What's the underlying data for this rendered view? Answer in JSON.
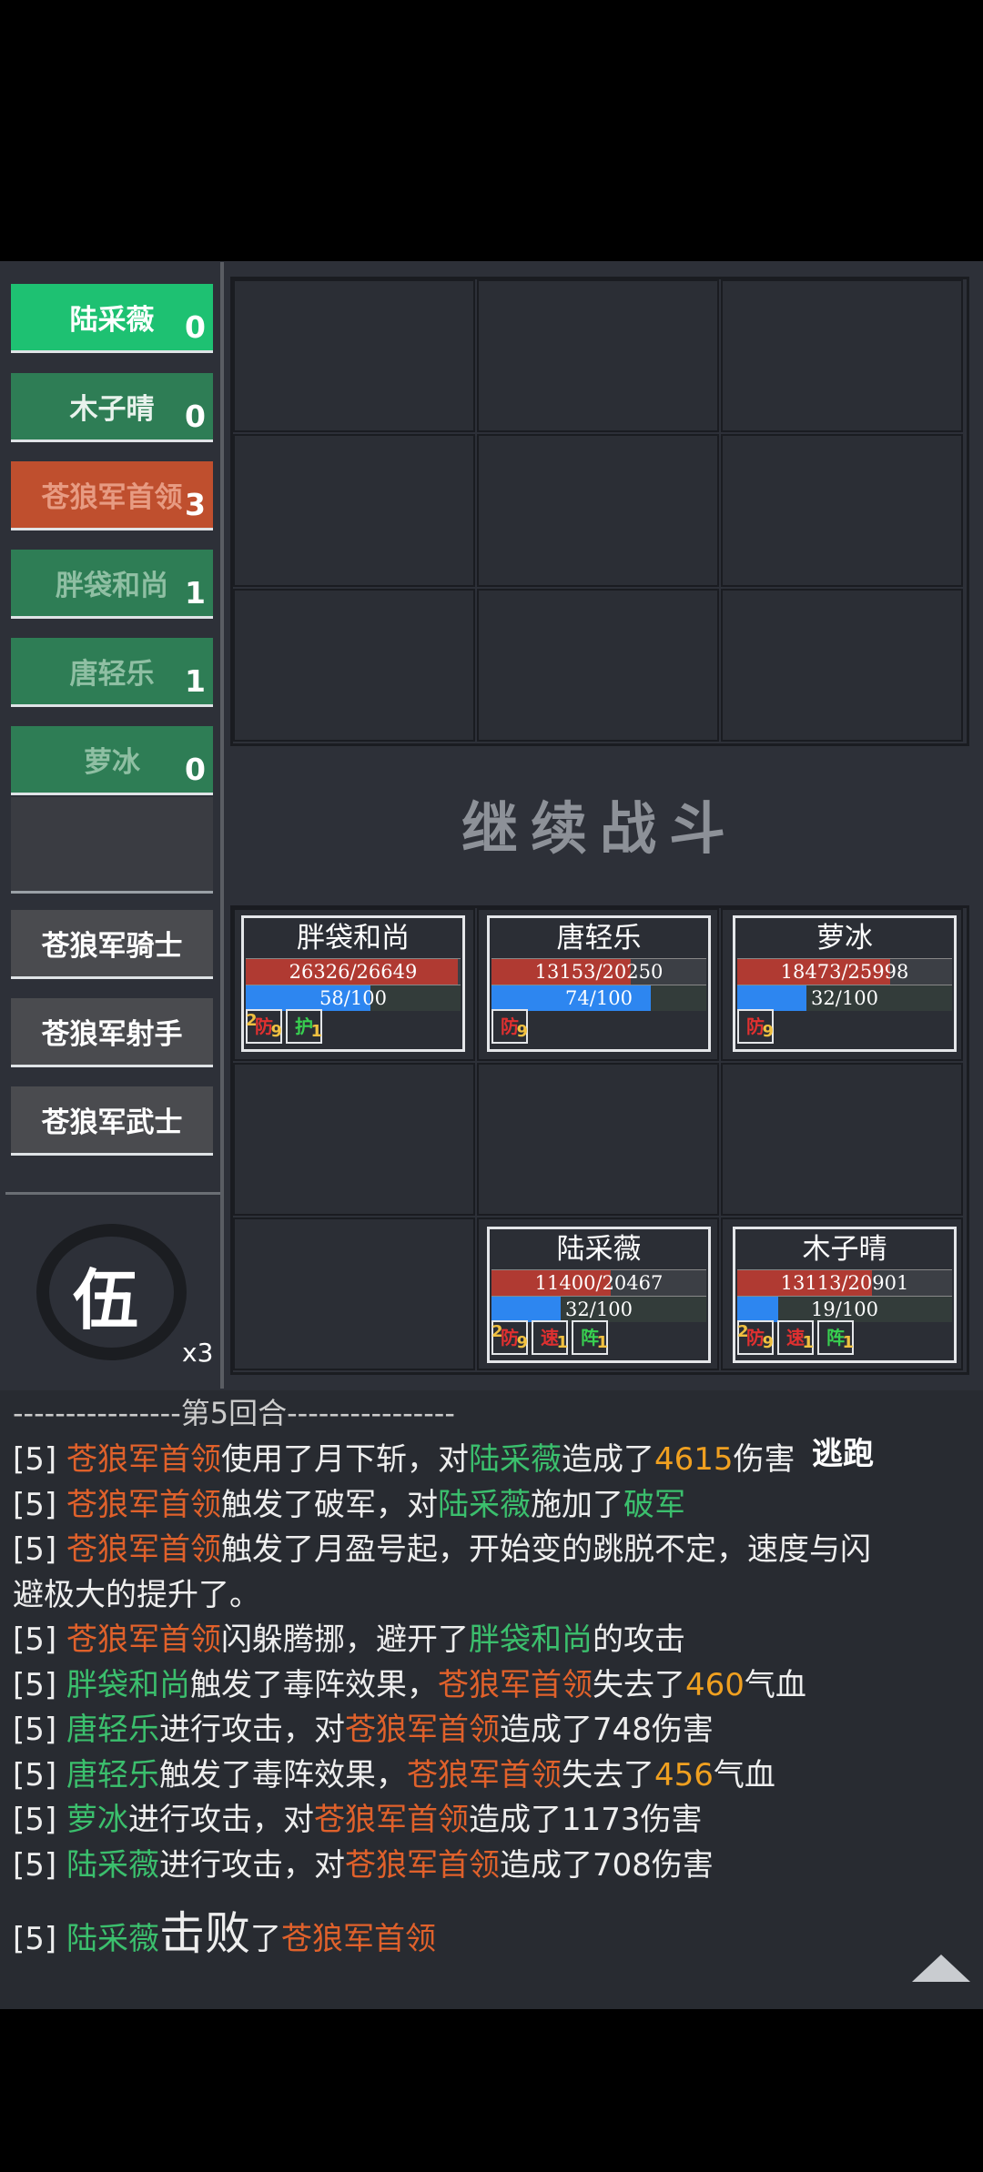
{
  "turn_order": [
    {
      "name": "陆采薇",
      "count": "0"
    },
    {
      "name": "木子晴",
      "count": "0"
    },
    {
      "name": "苍狼军首领",
      "count": "3"
    },
    {
      "name": "胖袋和尚",
      "count": "1"
    },
    {
      "name": "唐轻乐",
      "count": "1"
    },
    {
      "name": "萝冰",
      "count": "0"
    }
  ],
  "enemies": [
    "苍狼军骑士",
    "苍狼军射手",
    "苍狼军武士"
  ],
  "continue_label": "继续战斗",
  "heroes": [
    {
      "name": "胖袋和尚",
      "hp": "26326/26649",
      "hp_frac": 0.988,
      "mp": "58/100",
      "mp_frac": 0.58
    },
    {
      "name": "唐轻乐",
      "hp": "13153/20250",
      "hp_frac": 0.65,
      "mp": "74/100",
      "mp_frac": 0.74
    },
    {
      "name": "萝冰",
      "hp": "18473/25998",
      "hp_frac": 0.71,
      "mp": "32/100",
      "mp_frac": 0.32
    },
    {
      "name": "陆采薇",
      "hp": "11400/20467",
      "hp_frac": 0.557,
      "mp": "32/100",
      "mp_frac": 0.32
    },
    {
      "name": "木子晴",
      "hp": "13113/20901",
      "hp_frac": 0.627,
      "mp": "19/100",
      "mp_frac": 0.19
    }
  ],
  "buffs": {
    "h0": [
      {
        "label": "防",
        "stack": "2",
        "level": "9",
        "color": "red"
      },
      {
        "label": "护",
        "stack": "",
        "level": "1",
        "color": "green"
      }
    ],
    "h1": [
      {
        "label": "防",
        "stack": "",
        "level": "9",
        "color": "red"
      }
    ],
    "h2": [
      {
        "label": "防",
        "stack": "",
        "level": "9",
        "color": "red"
      }
    ],
    "h3": [
      {
        "label": "防",
        "stack": "2",
        "level": "9",
        "color": "red"
      },
      {
        "label": "速",
        "stack": "",
        "level": "1",
        "color": "red"
      },
      {
        "label": "阵",
        "stack": "",
        "level": "1",
        "color": "green"
      }
    ],
    "h4": [
      {
        "label": "防",
        "stack": "2",
        "level": "9",
        "color": "red"
      },
      {
        "label": "速",
        "stack": "",
        "level": "1",
        "color": "red"
      },
      {
        "label": "阵",
        "stack": "",
        "level": "1",
        "color": "green"
      }
    ]
  },
  "formation": {
    "char": "伍",
    "multiplier": "x3"
  },
  "round_text": "----------------第5回合----------------",
  "flee_label": "逃跑",
  "log": [
    [
      {
        "t": "[5] "
      },
      {
        "t": "苍狼军首领",
        "c": "o"
      },
      {
        "t": "使用了月下斩，对"
      },
      {
        "t": "陆采薇",
        "c": "g"
      },
      {
        "t": "造成了"
      },
      {
        "t": "4615",
        "c": "y"
      },
      {
        "t": "伤害"
      }
    ],
    [
      {
        "t": "[5] "
      },
      {
        "t": "苍狼军首领",
        "c": "o"
      },
      {
        "t": "触发了破军，对"
      },
      {
        "t": "陆采薇",
        "c": "g"
      },
      {
        "t": "施加了"
      },
      {
        "t": "破军",
        "c": "g"
      }
    ],
    [
      {
        "t": "[5] "
      },
      {
        "t": "苍狼军首领",
        "c": "o"
      },
      {
        "t": "触发了月盈号起，开始变的跳脱不定，速度与闪"
      }
    ],
    [
      {
        "t": "避极大的提升了。"
      }
    ],
    [
      {
        "t": "[5] "
      },
      {
        "t": "苍狼军首领",
        "c": "o"
      },
      {
        "t": "闪躲腾挪，避开了"
      },
      {
        "t": "胖袋和尚",
        "c": "g"
      },
      {
        "t": "的攻击"
      }
    ],
    [
      {
        "t": "[5] "
      },
      {
        "t": "胖袋和尚",
        "c": "g"
      },
      {
        "t": "触发了毒阵效果，"
      },
      {
        "t": "苍狼军首领",
        "c": "o"
      },
      {
        "t": "失去了"
      },
      {
        "t": "460",
        "c": "y"
      },
      {
        "t": "气血"
      }
    ],
    [
      {
        "t": "[5] "
      },
      {
        "t": "唐轻乐",
        "c": "g"
      },
      {
        "t": "进行攻击，对"
      },
      {
        "t": "苍狼军首领",
        "c": "o"
      },
      {
        "t": "造成了748伤害"
      }
    ],
    [
      {
        "t": "[5] "
      },
      {
        "t": "唐轻乐",
        "c": "g"
      },
      {
        "t": "触发了毒阵效果，"
      },
      {
        "t": "苍狼军首领",
        "c": "o"
      },
      {
        "t": "失去了"
      },
      {
        "t": "456",
        "c": "y"
      },
      {
        "t": "气血"
      }
    ],
    [
      {
        "t": "[5] "
      },
      {
        "t": "萝冰",
        "c": "g"
      },
      {
        "t": "进行攻击，对"
      },
      {
        "t": "苍狼军首领",
        "c": "o"
      },
      {
        "t": "造成了1173伤害"
      }
    ],
    [
      {
        "t": "[5] "
      },
      {
        "t": "陆采薇",
        "c": "g"
      },
      {
        "t": "进行攻击，对"
      },
      {
        "t": "苍狼军首领",
        "c": "o"
      },
      {
        "t": "造成了708伤害"
      }
    ],
    [
      {
        "t": "[5] "
      },
      {
        "t": "陆采薇",
        "c": "g"
      },
      {
        "t": "击败",
        "big": true
      },
      {
        "t": "了"
      },
      {
        "t": "苍狼军首领",
        "c": "o"
      }
    ]
  ]
}
